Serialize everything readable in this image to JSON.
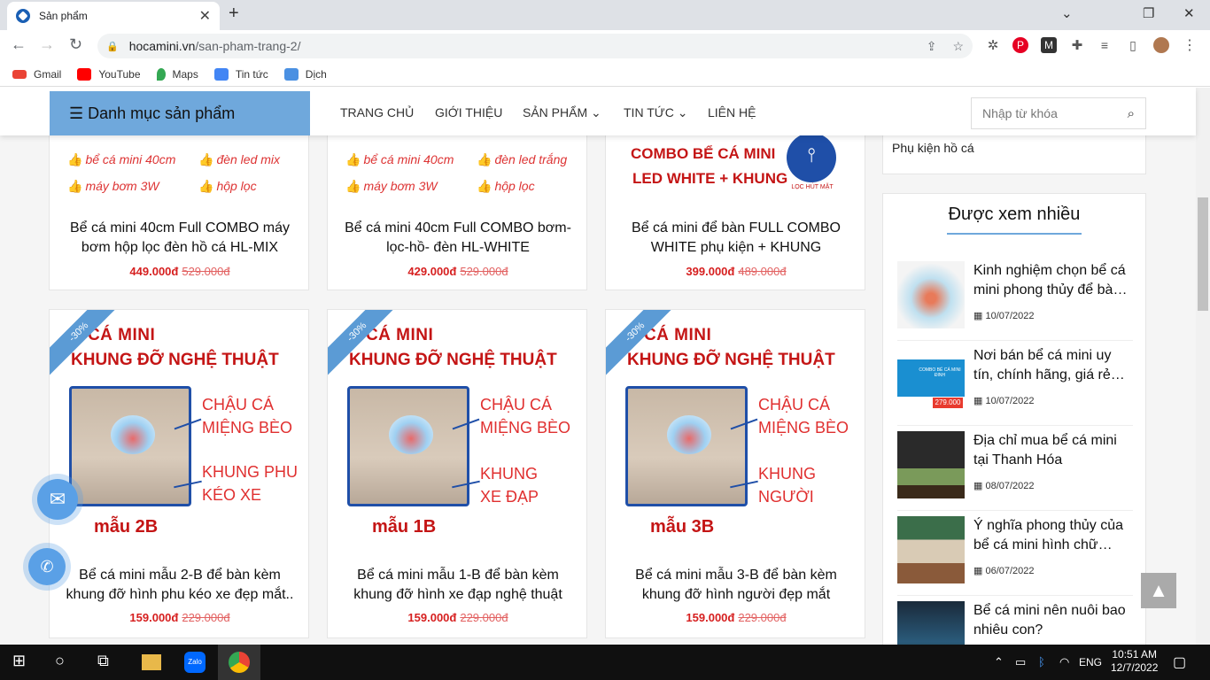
{
  "browser": {
    "tab_title": "Sản phẩm",
    "url_domain": "hocamini.vn",
    "url_path": "/san-pham-trang-2/",
    "bookmarks": [
      "Gmail",
      "YouTube",
      "Maps",
      "Tin tức",
      "Dịch"
    ]
  },
  "header": {
    "category_label": "☰ Danh mục sản phẩm",
    "menu": [
      "TRANG CHỦ",
      "GIỚI THIỆU",
      "SẢN PHẨM ⌄",
      "TIN TỨC ⌄",
      "LIÊN HỆ"
    ],
    "search_placeholder": "Nhập từ khóa"
  },
  "products_top": [
    {
      "features": [
        "bể cá mini 40cm",
        "đèn led mix",
        "máy bơm 3W",
        "hộp lọc"
      ],
      "title": "Bể cá mini 40cm Full COMBO máy bơm hộp lọc đèn hồ cá HL-MIX",
      "price": "449.000đ",
      "old_price": "529.000đ"
    },
    {
      "features": [
        "bể cá mini 40cm",
        "đèn led trắng",
        "máy bơm 3W",
        "hộp lọc"
      ],
      "title": "Bể cá mini 40cm Full COMBO bơm-lọc-hồ- đèn HL-WHITE",
      "price": "429.000đ",
      "old_price": "529.000đ"
    },
    {
      "banner": [
        "COMBO BỂ CÁ MINI",
        "LED WHITE + KHUNG"
      ],
      "badge": "LỌC HÚT MẶT",
      "title": "Bể cá mini để bàn FULL COMBO WHITE phụ kiện + KHUNG",
      "price": "399.000đ",
      "old_price": "489.000đ"
    }
  ],
  "products_bottom": [
    {
      "discount": "-30%",
      "banner_1": "Ể CÁ MINI",
      "banner_2": "KHUNG ĐỠ NGHỆ THUẬT",
      "label_1a": "CHẬU CÁ",
      "label_1b": "MIỆNG BÈO",
      "label_2a": "KHUNG PHU",
      "label_2b": "KÉO XE",
      "model": "mẫu 2B",
      "title": "Bể cá mini mẫu 2-B để bàn kèm khung đỡ hình phu kéo xe đẹp mắt..",
      "price": "159.000đ",
      "old_price": "229.000đ"
    },
    {
      "discount": "-30%",
      "banner_1": "Ể CÁ MINI",
      "banner_2": "KHUNG ĐỠ NGHỆ THUẬT",
      "label_1a": "CHẬU CÁ",
      "label_1b": "MIỆNG BÈO",
      "label_2a": "KHUNG",
      "label_2b": "XE ĐẠP",
      "model": "mẫu 1B",
      "title": "Bể cá mini mẫu 1-B để bàn kèm khung đỡ hình xe đạp nghệ thuật",
      "price": "159.000đ",
      "old_price": "229.000đ"
    },
    {
      "discount": "-30%",
      "banner_1": "Ể CÁ MINI",
      "banner_2": "KHUNG ĐỠ NGHỆ THUẬT",
      "label_1a": "CHẬU CÁ",
      "label_1b": "MIỆNG BÈO",
      "label_2a": "KHUNG",
      "label_2b": "NGƯỜI",
      "model": "mẫu 3B",
      "title": "Bể cá mini mẫu 3-B để bàn kèm khung đỡ hình người đẹp mắt",
      "price": "159.000đ",
      "old_price": "229.000đ"
    }
  ],
  "sidebar": {
    "category_item": "Phụ kiện hồ cá",
    "viewed_title": "Được xem nhiều",
    "posts": [
      {
        "title": "Kinh nghiệm chọn bể cá mini phong thủy để bà…",
        "date": "10/07/2022"
      },
      {
        "title": "Nơi bán bể cá mini uy tín, chính hãng, giá rẻ…",
        "date": "10/07/2022"
      },
      {
        "title": "Địa chỉ mua bể cá mini tại Thanh Hóa",
        "date": "08/07/2022"
      },
      {
        "title": "Ý nghĩa phong thủy của bể cá mini hình chữ…",
        "date": "06/07/2022"
      },
      {
        "title": "Bể cá mini nên nuôi bao nhiêu con?",
        "date": ""
      }
    ],
    "thumb_banner": "COMBO BỂ CÁ MINI ĐINH",
    "thumb_price": "279.000"
  },
  "taskbar": {
    "lang": "ENG",
    "time": "10:51 AM",
    "date": "12/7/2022"
  }
}
